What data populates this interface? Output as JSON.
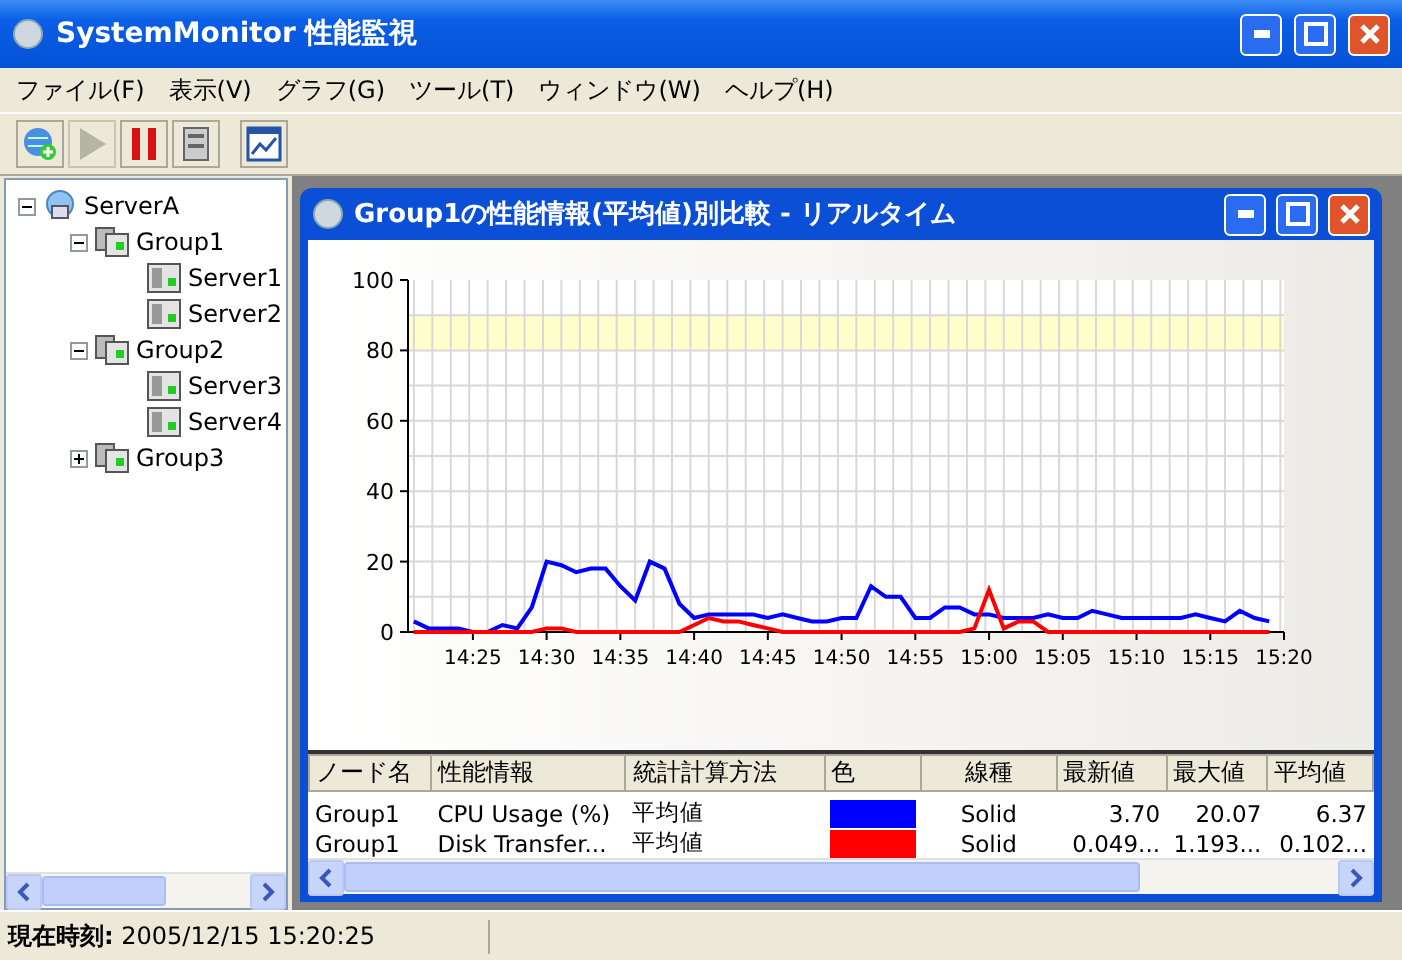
{
  "window": {
    "title": "SystemMonitor 性能監視"
  },
  "menu": [
    "ファイル(F)",
    "表示(V)",
    "グラフ(G)",
    "ツール(T)",
    "ウィンドウ(W)",
    "ヘルプ(H)"
  ],
  "toolbar": [
    {
      "kind": "add",
      "disabled": false
    },
    {
      "kind": "play",
      "disabled": true
    },
    {
      "kind": "pause",
      "disabled": false
    },
    {
      "kind": "server",
      "disabled": false
    },
    {
      "kind": "chart",
      "disabled": false
    }
  ],
  "tree": [
    {
      "label": "ServerA",
      "kind": "network",
      "expanded": true,
      "children": [
        {
          "label": "Group1",
          "kind": "group",
          "expanded": true,
          "children": [
            {
              "label": "Server1",
              "kind": "server"
            },
            {
              "label": "Server2",
              "kind": "server"
            }
          ]
        },
        {
          "label": "Group2",
          "kind": "group",
          "expanded": true,
          "children": [
            {
              "label": "Server3",
              "kind": "server"
            },
            {
              "label": "Server4",
              "kind": "server"
            }
          ]
        },
        {
          "label": "Group3",
          "kind": "group",
          "expanded": false
        }
      ]
    }
  ],
  "child_window": {
    "title": "Group1の性能情報(平均値)別比較 - リアルタイム",
    "chart": {
      "chart_data": {
        "type": "line",
        "categories": [
          null,
          null,
          null,
          null,
          "14:25",
          null,
          null,
          null,
          null,
          "14:30",
          null,
          null,
          null,
          null,
          "14:35",
          null,
          null,
          null,
          null,
          "14:40",
          null,
          null,
          null,
          null,
          "14:45",
          null,
          null,
          null,
          null,
          "14:50",
          null,
          null,
          null,
          null,
          "14:55",
          null,
          null,
          null,
          null,
          "15:00",
          null,
          null,
          null,
          null,
          "15:05",
          null,
          null,
          null,
          null,
          "15:10",
          null,
          null,
          null,
          null,
          "15:15",
          null,
          null,
          null,
          null,
          "15:20"
        ],
        "series": [
          {
            "color": "#0000ff",
            "values": [
              3,
              1,
              1,
              1,
              0,
              0,
              2,
              1,
              7,
              20,
              19,
              17,
              18,
              18,
              13,
              9,
              20,
              18,
              8,
              4,
              5,
              5,
              5,
              5,
              4,
              5,
              4,
              3,
              3,
              4,
              4,
              13,
              10,
              10,
              4,
              4,
              7,
              7,
              5,
              5,
              4,
              4,
              4,
              5,
              4,
              4,
              6,
              5,
              4,
              4,
              4,
              4,
              4,
              5,
              4,
              3,
              6,
              4,
              3,
              null
            ]
          },
          {
            "color": "#ff0000",
            "values": [
              0,
              0,
              0,
              0,
              0,
              0,
              0,
              0,
              0,
              1,
              1,
              0,
              0,
              0,
              0,
              0,
              0,
              0,
              0,
              2,
              4,
              3,
              3,
              2,
              1,
              0,
              0,
              0,
              0,
              0,
              0,
              0,
              0,
              0,
              0,
              0,
              0,
              0,
              1,
              12,
              1,
              3,
              3,
              0,
              0,
              0,
              0,
              0,
              0,
              0,
              0,
              0,
              0,
              0,
              0,
              0,
              0,
              0,
              0,
              null
            ]
          }
        ],
        "ylim": [
          0,
          100
        ],
        "yticks": [
          0,
          20,
          40,
          60,
          80,
          100
        ],
        "grid": true,
        "bands": [
          {
            "axis": "y",
            "from": 80,
            "to": 90,
            "color": "#ffffcc"
          }
        ]
      }
    },
    "table": {
      "columns": [
        "ノード名",
        "性能情報",
        "統計計算方法",
        "色",
        "線種",
        "最新値",
        "最大値",
        "平均値"
      ],
      "rows": [
        {
          "node": "Group1",
          "metric": "CPU Usage (%)",
          "method": "平均値",
          "color": "#0000ff",
          "line": "Solid",
          "latest": "3.70",
          "max": "20.07",
          "avg": "6.37"
        },
        {
          "node": "Group1",
          "metric": "Disk Transfer...",
          "method": "平均値",
          "color": "#ff0000",
          "line": "Solid",
          "latest": "0.049...",
          "max": "1.193...",
          "avg": "0.102..."
        }
      ]
    }
  },
  "status_bar": {
    "text": "**現在時刻:** 2005/12/15 15:20:25"
  }
}
